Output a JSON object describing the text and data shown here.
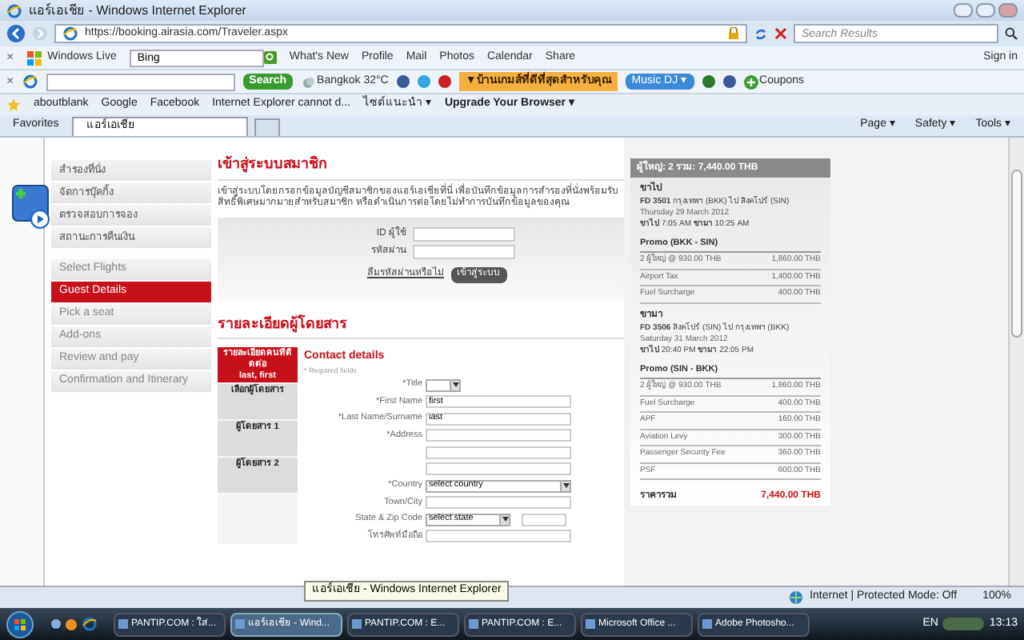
{
  "window": {
    "title": "แอร์เอเชีย - Windows Internet Explorer"
  },
  "address_bar": {
    "url": "https://booking.airasia.com/Traveler.aspx",
    "search_placeholder": "Search Results"
  },
  "live_toolbar": {
    "close_symbol": "×",
    "brand": "Windows Live",
    "search_value": "Bing",
    "links": [
      "What's New",
      "Profile",
      "Mail",
      "Photos",
      "Calendar",
      "Share"
    ],
    "sign_in": "Sign in"
  },
  "search_toolbar": {
    "close_symbol": "×",
    "search_button": "Search",
    "weather": "Bangkok 32°C",
    "promo": "▼บ้านเกมส์ที่ดีที่สุดสำหรับคุณ",
    "music": "Music DJ ▾",
    "coupons": "Coupons"
  },
  "favorites_bar": [
    "aboutblank",
    "Google",
    "Facebook",
    "Internet Explorer cannot d...",
    "ไซต์แนะนำ ▾",
    "Upgrade Your Browser ▾"
  ],
  "tab_row": {
    "favorites": "Favorites",
    "tabs": [
      {
        "label": "แอร์เอเชีย",
        "selected": true
      }
    ],
    "commands": [
      "Page ▾",
      "Safety ▾",
      "Tools ▾"
    ]
  },
  "sidebar": {
    "member_links": [
      "สำรองที่นั่ง",
      "จัดการบุ๊คกิ้ง",
      "ตรวจสอบการจอง",
      "สถานะการคืนเงิน"
    ],
    "steps": [
      {
        "label": "Select Flights",
        "selected": false
      },
      {
        "label": "Guest Details",
        "selected": true
      },
      {
        "label": "Pick a seat",
        "selected": false
      },
      {
        "label": "Add-ons",
        "selected": false
      },
      {
        "label": "Review and pay",
        "selected": false
      },
      {
        "label": "Confirmation and Itinerary",
        "selected": false
      }
    ]
  },
  "login": {
    "heading": "เข้าสู่ระบบสมาชิก",
    "intro": "เข้าสู่ระบบโดยกรอกข้อมูลบัญชีสมาชิกของแอร์เอเชียที่นี่ เพื่อบันทึกข้อมูลการสำรองที่นั่งพร้อมรับสิทธิ์พิเศษมากมายสำหรับสมาชิก หรือดำเนินการต่อโดยไม่ทำการบันทึกข้อมูลของคุณ",
    "user_label": "ID ผู้ใช้",
    "password_label": "รหัสผ่าน",
    "forgot": "ลืมรหัสผ่านหรือไม่",
    "button": "เข้าสู่ระบบ"
  },
  "passengers": {
    "heading": "รายละเอียดผู้โดยสาร",
    "tabs": [
      {
        "label": "รายละเอียดคนที่ติดต่อ",
        "sub": "last, first",
        "selected": true
      },
      {
        "label": "เลือกผู้โดยสาร",
        "selected": false
      },
      {
        "label": "ผู้โดยสาร 1",
        "selected": false
      },
      {
        "label": "ผู้โดยสาร 2",
        "selected": false
      }
    ],
    "form_title": "Contact details",
    "required_note": "* Required fields",
    "fields": [
      {
        "kind": "select",
        "label": "*Title"
      },
      {
        "kind": "text",
        "label": "*First Name",
        "value": "first"
      },
      {
        "kind": "text",
        "label": "*Last Name/Surname",
        "value": "last"
      },
      {
        "kind": "text",
        "label": "*Address"
      },
      {
        "kind": "text"
      },
      {
        "kind": "text"
      },
      {
        "kind": "select_wide",
        "label": "*Country",
        "value": "select country"
      },
      {
        "kind": "text",
        "label": "Town/City"
      },
      {
        "kind": "select_zip",
        "label": "State & Zip Code",
        "value": "select state"
      },
      {
        "kind": "text",
        "label": "โทรศัพท์มือถือ"
      }
    ]
  },
  "summary": {
    "header": "ผู้ใหญ่: 2 รวม: 7,440.00 THB",
    "legs": [
      {
        "direction": "ขาไป",
        "flight": "**FD 3501** กรุงเทพฯ (BKK) ไป สิงคโปร์ (SIN)",
        "date": "Thursday 29 March 2012",
        "times": "**ขาไป** 7:05 AM **ขามา** 10:25 AM",
        "fare": "Promo (BKK - SIN)",
        "rows": [
          {
            "label": "2 ผู้ใหญ่ @ 930.00 THB",
            "amount": "1,860.00 THB"
          },
          {
            "label": "Airport Tax",
            "amount": "1,400.00 THB"
          },
          {
            "label": "Fuel Surcharge",
            "amount": "400.00 THB"
          }
        ]
      },
      {
        "direction": "ขามา",
        "flight": "**FD 3506** สิงคโปร์ (SIN) ไป กรุงเทพฯ (BKK)",
        "date": "Saturday 31 March 2012",
        "times": "**ขาไป** 20:40 PM **ขามา** 22:05 PM",
        "fare": "Promo (SIN - BKK)",
        "rows": [
          {
            "label": "2 ผู้ใหญ่ @ 930.00 THB",
            "amount": "1,860.00 THB"
          },
          {
            "label": "Fuel Surcharge",
            "amount": "400.00 THB"
          },
          {
            "label": "APF",
            "amount": "160.00 THB"
          },
          {
            "label": "Aviation Levy",
            "amount": "300.00 THB"
          },
          {
            "label": "Passenger Security Fee",
            "amount": "360.00 THB"
          },
          {
            "label": "PSF",
            "amount": "600.00 THB"
          }
        ]
      }
    ],
    "total_label": "ราคารวม",
    "total": "7,440.00 THB"
  },
  "status_bar": {
    "tooltip": "แอร์เอเชีย - Windows Internet Explorer",
    "zone": "Internet | Protected Mode: Off",
    "zoom": "100%"
  },
  "taskbar": {
    "items": [
      {
        "label": "PANTIP.COM : ใส่...",
        "selected": false
      },
      {
        "label": "แอร์เอเชีย - Wind...",
        "selected": true
      },
      {
        "label": "PANTIP.COM : E...",
        "selected": false
      },
      {
        "label": "PANTIP.COM : E...",
        "selected": false
      },
      {
        "label": "Microsoft Office ...",
        "selected": false
      },
      {
        "label": "Adobe Photosho...",
        "selected": false
      }
    ],
    "language": "EN",
    "clock": "13:13"
  }
}
